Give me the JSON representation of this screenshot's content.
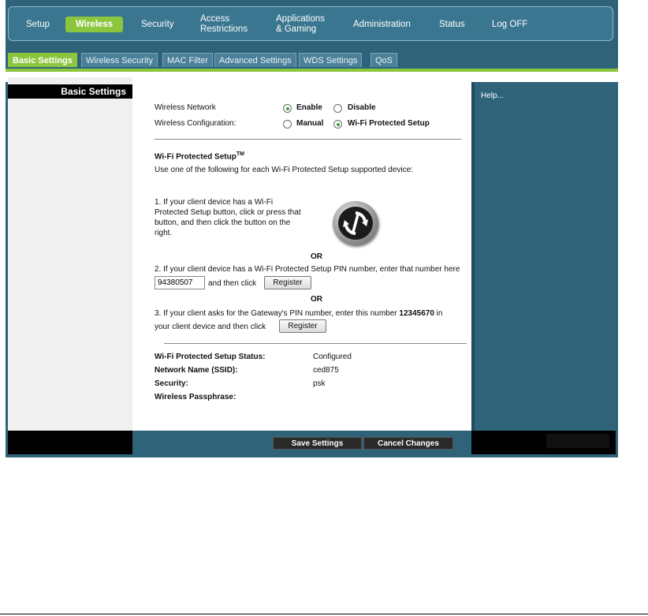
{
  "nav": {
    "items": [
      "Setup",
      "Wireless",
      "Security",
      "Access\nRestrictions",
      "Applications\n& Gaming",
      "Administration",
      "Status",
      "Log OFF"
    ],
    "active": "Wireless"
  },
  "tabs": [
    "Basic Settings",
    "Wireless Security",
    "MAC Filter",
    "Advanced Settings",
    "WDS Settings",
    "QoS"
  ],
  "active_tab": "Basic Settings",
  "section_title": "Basic Settings",
  "help": "Help...",
  "form": {
    "wireless_network_label": "Wireless Network",
    "enable_label": "Enable",
    "disable_label": "Disable",
    "wireless_network_value": "Enable",
    "wireless_config_label": "Wireless Configuration:",
    "manual_label": "Manual",
    "wps_label": "Wi-Fi Protected Setup",
    "wireless_config_value": "Wi-Fi Protected Setup"
  },
  "wps": {
    "title": "Wi-Fi Protected Setup",
    "title_sup": "TM",
    "intro": "Use one of the following for each Wi-Fi Protected Setup supported device:",
    "opt1_lines": [
      "1. If your client device has a Wi-Fi",
      "Protected Setup button, click or press that",
      "button, and then click the button on the",
      "right."
    ],
    "or": "OR",
    "opt2_text": "2. If your client device has a Wi-Fi Protected Setup PIN number, enter that number here",
    "pin_value": "94380507",
    "opt2_suffix": "and then click",
    "register_label": "Register",
    "opt3_prefix": "3. If your client asks for the Gateway's PIN number, enter this number ",
    "gateway_pin": "12345670",
    "opt3_in": " in",
    "opt3_line2": "your client device  and then click"
  },
  "status": {
    "wps_status_label": "Wi-Fi Protected Setup Status:",
    "wps_status_value": "Configured",
    "ssid_label": "Network Name (SSID):",
    "ssid_value": "ced875",
    "security_label": "Security:",
    "security_value": "psk",
    "passphrase_label": "Wireless Passphrase:",
    "passphrase_value": ""
  },
  "buttons": {
    "save": "Save Settings",
    "cancel": "Cancel Changes"
  },
  "colors": {
    "accent_green": "#8cc63f",
    "frame_blue": "#2f6379"
  }
}
